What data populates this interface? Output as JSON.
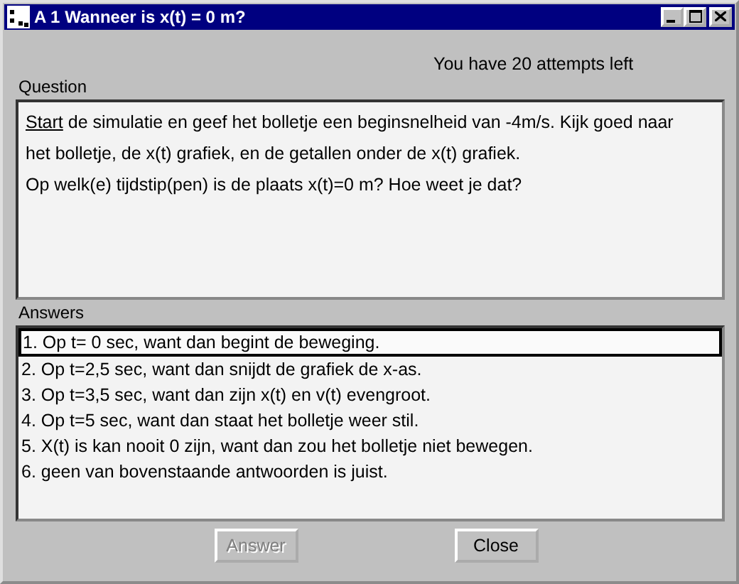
{
  "window": {
    "title": "A 1 Wanneer is x(t) = 0 m?"
  },
  "attempts": "You have 20 attempts left",
  "question": {
    "label": "Question",
    "link": "Start",
    "lines": [
      " de simulatie en geef het bolletje een beginsnelheid van -4m/s.  Kijk goed naar",
      "het bolletje, de x(t) grafiek, en de getallen onder de x(t) grafiek.",
      "Op welk(e) tijdstip(pen) is de plaats x(t)=0 m? Hoe weet je dat?"
    ]
  },
  "answers": {
    "label": "Answers",
    "items": [
      {
        "text": "1. Op t= 0 sec, want dan begint de beweging.",
        "selected": true
      },
      {
        "text": "2. Op t=2,5 sec, want dan snijdt de grafiek de x-as.",
        "selected": false
      },
      {
        "text": "3. Op t=3,5 sec, want dan zijn x(t) en v(t) evengroot.",
        "selected": false
      },
      {
        "text": "4. Op t=5 sec, want dan staat het bolletje weer stil.",
        "selected": false
      },
      {
        "text": "5. X(t) is kan nooit 0 zijn, want dan zou het bolletje niet bewegen.",
        "selected": false
      },
      {
        "text": "6. geen van bovenstaande antwoorden is juist.",
        "selected": false
      }
    ]
  },
  "buttons": [
    {
      "label": "Answer",
      "disabled": true
    },
    {
      "label": "Close",
      "disabled": false
    }
  ]
}
